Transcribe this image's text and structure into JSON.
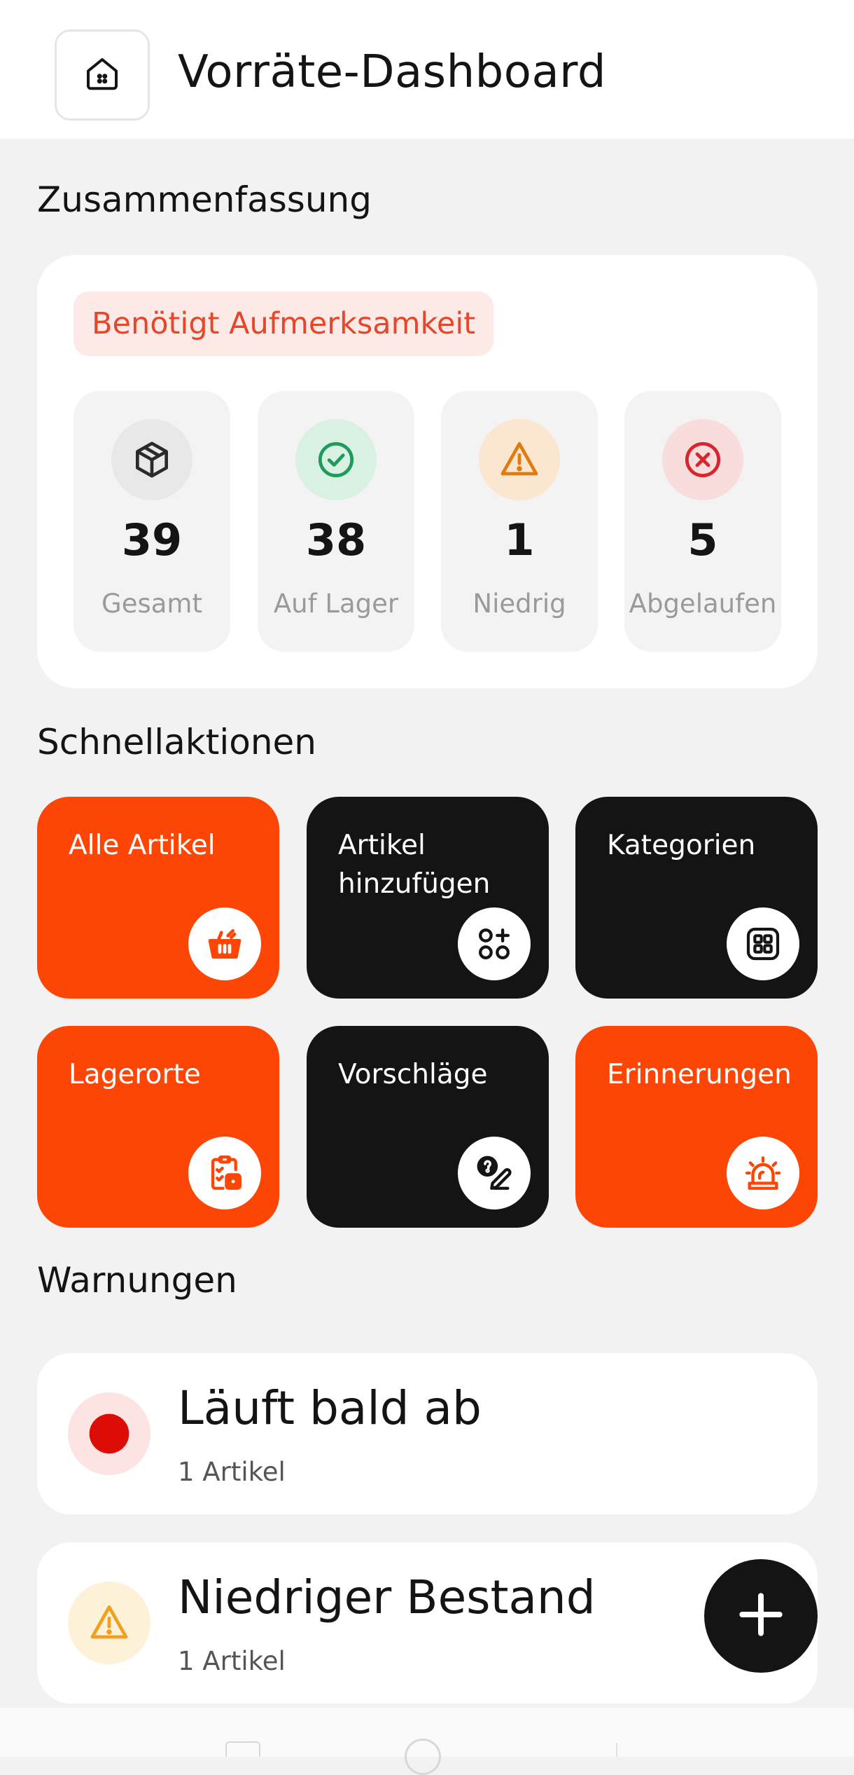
{
  "header": {
    "title": "Vorräte-Dashboard"
  },
  "summary": {
    "section_title": "Zusammenfassung",
    "badge": "Benötigt Aufmerksamkeit",
    "stats": [
      {
        "value": "39",
        "label": "Gesamt",
        "icon": "box-icon",
        "color": "#2a2a2a",
        "bg": "#e8e8e8"
      },
      {
        "value": "38",
        "label": "Auf Lager",
        "icon": "check-circle-icon",
        "color": "#1f9a5a",
        "bg": "#d8f1e2"
      },
      {
        "value": "1",
        "label": "Niedrig",
        "icon": "warning-triangle-icon",
        "color": "#e07b12",
        "bg": "#fbe7cf"
      },
      {
        "value": "5",
        "label": "Abgelaufen",
        "icon": "x-circle-icon",
        "color": "#d7262f",
        "bg": "#f9dcdc"
      }
    ]
  },
  "quick_actions": {
    "section_title": "Schnellaktionen",
    "tiles": [
      {
        "label": "Alle Artikel",
        "icon": "basket-icon",
        "style": "orange"
      },
      {
        "label": "Artikel hinzufügen",
        "icon": "add-grid-icon",
        "style": "black"
      },
      {
        "label": "Kategorien",
        "icon": "grid-icon",
        "style": "black"
      },
      {
        "label": "Lagerorte",
        "icon": "clipboard-icon",
        "style": "orange"
      },
      {
        "label": "Vorschläge",
        "icon": "suggestion-icon",
        "style": "black"
      },
      {
        "label": "Erinnerungen",
        "icon": "alarm-icon",
        "style": "orange"
      }
    ]
  },
  "warnings": {
    "section_title": "Warnungen",
    "items": [
      {
        "title": "Läuft bald ab",
        "subtitle": "1 Artikel",
        "icon": "red-dot-icon",
        "color": "#dc0d06",
        "bg": "#fde3e2"
      },
      {
        "title": "Niedriger Bestand",
        "subtitle": "1 Artikel",
        "icon": "warning-triangle-icon",
        "color": "#f0a020",
        "bg": "#fdf1d8"
      }
    ]
  },
  "colors": {
    "accent": "#fd4606",
    "dark": "#141414",
    "background": "#f2f2f2"
  }
}
